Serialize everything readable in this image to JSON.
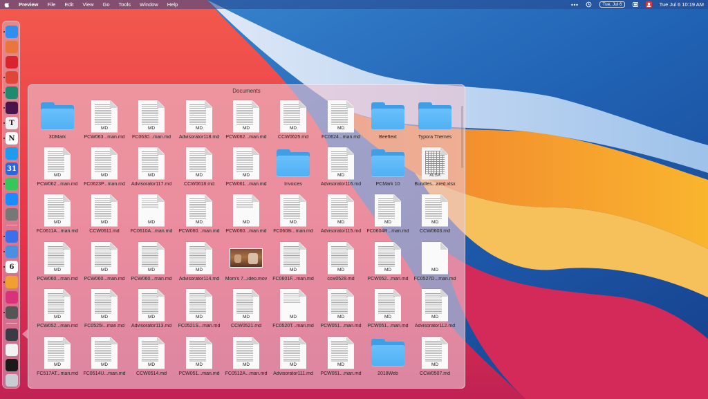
{
  "menubar": {
    "apple": "apple-logo-icon",
    "app_name": "Preview",
    "items": [
      "File",
      "Edit",
      "View",
      "Go",
      "Tools",
      "Window",
      "Help"
    ],
    "status": {
      "date_chip": "Tue, Jul 6",
      "clock": "Tue Jul 6  10:19 AM"
    }
  },
  "dock": {
    "apps": [
      {
        "name": "finder-icon",
        "color": "#2f8ef0"
      },
      {
        "name": "launchpad-icon",
        "color": "#e9773d"
      },
      {
        "name": "creative-cloud-icon",
        "color": "#d9232e"
      },
      {
        "name": "gmail-icon",
        "color": "#e0453a"
      },
      {
        "name": "edge-icon",
        "color": "#1f8a70"
      },
      {
        "name": "slack-icon",
        "color": "#4a154b"
      },
      {
        "name": "typora-icon",
        "color": "#f0f0f0",
        "glyph": "T"
      },
      {
        "name": "notion-icon",
        "color": "#ffffff",
        "glyph": "N"
      },
      {
        "name": "twitter-icon",
        "color": "#1d9bf0"
      },
      {
        "name": "calendar-icon",
        "color": "#2b67d8",
        "glyph": "31"
      },
      {
        "name": "messages-icon",
        "color": "#34c759"
      },
      {
        "name": "app-store-icon",
        "color": "#1a8cff"
      },
      {
        "name": "system-preferences-icon",
        "color": "#777777"
      },
      {
        "name": "klokki-icon",
        "color": "#3d6fe8"
      },
      {
        "name": "preview-icon",
        "color": "#4a8fe0"
      },
      {
        "name": "fantastical-icon",
        "color": "#ffffff",
        "glyph": "6"
      },
      {
        "name": "pixelmator-icon",
        "color": "#f0a030"
      },
      {
        "name": "affinity-photo-icon",
        "color": "#d9327b"
      },
      {
        "name": "quicktime-icon",
        "color": "#555555"
      },
      {
        "name": "downloads-stack-icon",
        "color": "#3b3b46"
      },
      {
        "name": "documents-stack-icon",
        "color": "#f2f2f2"
      },
      {
        "name": "screenshot-stack-icon",
        "color": "#1a1a1a"
      },
      {
        "name": "trash-icon",
        "color": "#c9cdd3"
      }
    ]
  },
  "stack": {
    "title": "Documents",
    "items": [
      {
        "label": "3DMark",
        "kind": "folder"
      },
      {
        "label": "PCW063...man.md",
        "kind": "doc",
        "tag": "MD"
      },
      {
        "label": "FC0630...man.md",
        "kind": "doc",
        "tag": "MD"
      },
      {
        "label": "Advisorator118.md",
        "kind": "doc",
        "tag": "MD"
      },
      {
        "label": "PCW062...man.md",
        "kind": "doc",
        "tag": "MD"
      },
      {
        "label": "CCW0625.md",
        "kind": "doc",
        "tag": "MD"
      },
      {
        "label": "FC0624...man.md",
        "kind": "doc",
        "tag": "MD"
      },
      {
        "label": "Beeftext",
        "kind": "folder"
      },
      {
        "label": "Typora Themes",
        "kind": "folder"
      },
      {
        "label": "PCW062...man.md",
        "kind": "doc",
        "tag": "MD"
      },
      {
        "label": "FC0623P...man.md",
        "kind": "doc",
        "tag": "MD"
      },
      {
        "label": "Advisorator117.md",
        "kind": "doc",
        "tag": "MD"
      },
      {
        "label": "CCW0618.md",
        "kind": "doc",
        "tag": "MD"
      },
      {
        "label": "PCW061...man.md",
        "kind": "doc",
        "tag": "MD"
      },
      {
        "label": "Invoices",
        "kind": "folder"
      },
      {
        "label": "Advisorator116.md",
        "kind": "doc",
        "tag": "MD"
      },
      {
        "label": "PCMark 10",
        "kind": "folder"
      },
      {
        "label": "Bundles...ared.xlsx",
        "kind": "xlsx",
        "tag": "XLSX"
      },
      {
        "label": "FC0611A...man.md",
        "kind": "doc",
        "tag": "MD"
      },
      {
        "label": "CCW0611.md",
        "kind": "doc",
        "tag": "MD"
      },
      {
        "label": "FC0610A...man.md",
        "kind": "doc-sparse",
        "tag": "MD"
      },
      {
        "label": "PCW060...man.md",
        "kind": "doc",
        "tag": "MD"
      },
      {
        "label": "PCW060...man.md",
        "kind": "doc-sparse",
        "tag": "MD"
      },
      {
        "label": "FC0608i...man.md",
        "kind": "doc",
        "tag": "MD"
      },
      {
        "label": "Advisorator115.md",
        "kind": "doc",
        "tag": "MD"
      },
      {
        "label": "FC0604R...man.md",
        "kind": "doc",
        "tag": "MD"
      },
      {
        "label": "CCW0603.md",
        "kind": "doc",
        "tag": "MD"
      },
      {
        "label": "PCW060...man.md",
        "kind": "doc",
        "tag": "MD"
      },
      {
        "label": "PCW060...man.md",
        "kind": "doc",
        "tag": "MD"
      },
      {
        "label": "PCW060...man.md",
        "kind": "doc",
        "tag": "MD"
      },
      {
        "label": "Advisorator114.md",
        "kind": "doc",
        "tag": "MD"
      },
      {
        "label": "Mom's 7...ideo.mov",
        "kind": "video"
      },
      {
        "label": "FC0601F...man.md",
        "kind": "doc",
        "tag": "MD"
      },
      {
        "label": "ccw0528.md",
        "kind": "doc",
        "tag": "MD"
      },
      {
        "label": "PCW052...man.md",
        "kind": "doc",
        "tag": "MD"
      },
      {
        "label": "FC0527D...man.md",
        "kind": "doc-blank",
        "tag": "MD"
      },
      {
        "label": "PCW052...man.md",
        "kind": "doc",
        "tag": "MD"
      },
      {
        "label": "FC0525I...man.md",
        "kind": "doc",
        "tag": "MD"
      },
      {
        "label": "Advisorator113.md",
        "kind": "doc",
        "tag": "MD"
      },
      {
        "label": "FC0521S...man.md",
        "kind": "doc",
        "tag": "MD"
      },
      {
        "label": "CCW0521.md",
        "kind": "doc",
        "tag": "MD"
      },
      {
        "label": "FC0520T...man.md",
        "kind": "doc-sparse",
        "tag": "MD"
      },
      {
        "label": "PCW051...man.md",
        "kind": "doc",
        "tag": "MD"
      },
      {
        "label": "PCW051...man.md",
        "kind": "doc",
        "tag": "MD"
      },
      {
        "label": "Advisorator112.md",
        "kind": "doc",
        "tag": "MD"
      },
      {
        "label": "FC517AT...man.md",
        "kind": "doc",
        "tag": "MD"
      },
      {
        "label": "FC0514U...man.md",
        "kind": "doc",
        "tag": "MD"
      },
      {
        "label": "CCW0514.md",
        "kind": "doc",
        "tag": "MD"
      },
      {
        "label": "PCW051...man.md",
        "kind": "doc",
        "tag": "MD"
      },
      {
        "label": "FC0512A...man.md",
        "kind": "doc",
        "tag": "MD"
      },
      {
        "label": "Advisorator111.md",
        "kind": "doc",
        "tag": "MD"
      },
      {
        "label": "PCW051...man.md",
        "kind": "doc",
        "tag": "MD"
      },
      {
        "label": "2018Web",
        "kind": "folder"
      },
      {
        "label": "CCW0507.md",
        "kind": "doc",
        "tag": "MD"
      }
    ]
  }
}
